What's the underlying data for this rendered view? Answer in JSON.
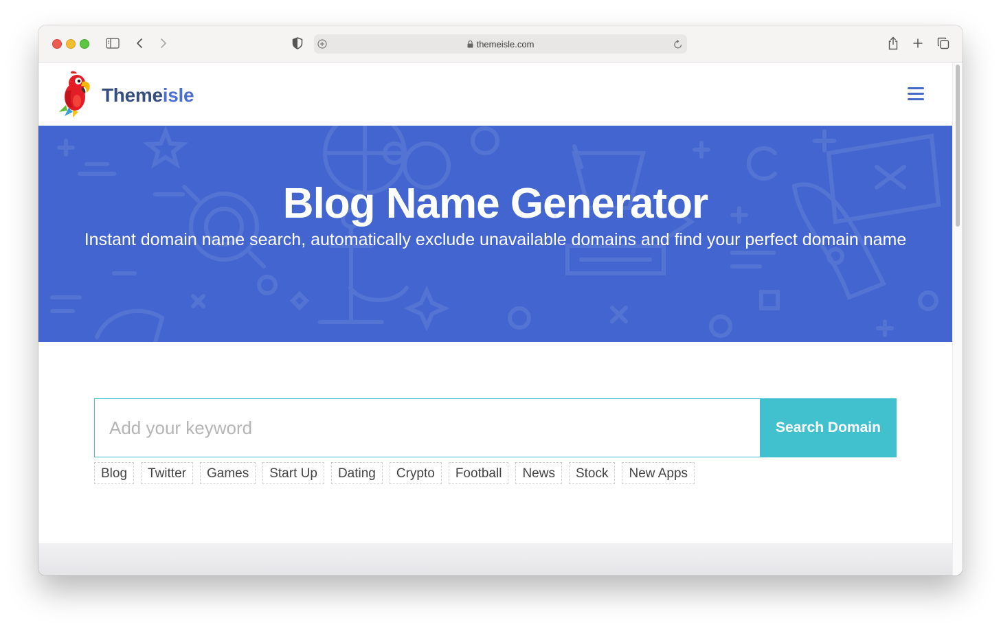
{
  "browser": {
    "url": "themeisle.com"
  },
  "site": {
    "logo_text_part1": "Theme",
    "logo_text_part2": "isle"
  },
  "hero": {
    "title": "Blog Name Generator",
    "subtitle": "Instant domain name search, automatically exclude unavailable domains and find your perfect domain name"
  },
  "search": {
    "placeholder": "Add your keyword",
    "value": "",
    "button_label": "Search Domain"
  },
  "tags": [
    "Blog",
    "Twitter",
    "Games",
    "Start Up",
    "Dating",
    "Crypto",
    "Football",
    "News",
    "Stock",
    "New Apps"
  ],
  "colors": {
    "hero_bg": "#4365cf",
    "accent": "#41c0ce",
    "logo_dark": "#364e7e",
    "logo_light": "#4a6fd0"
  },
  "icons": [
    "sidebar-icon",
    "back-icon",
    "forward-icon",
    "shield-icon",
    "page-settings-icon",
    "lock-icon",
    "reload-icon",
    "share-icon",
    "new-tab-icon",
    "tabs-overview-icon",
    "hamburger-menu-icon"
  ]
}
